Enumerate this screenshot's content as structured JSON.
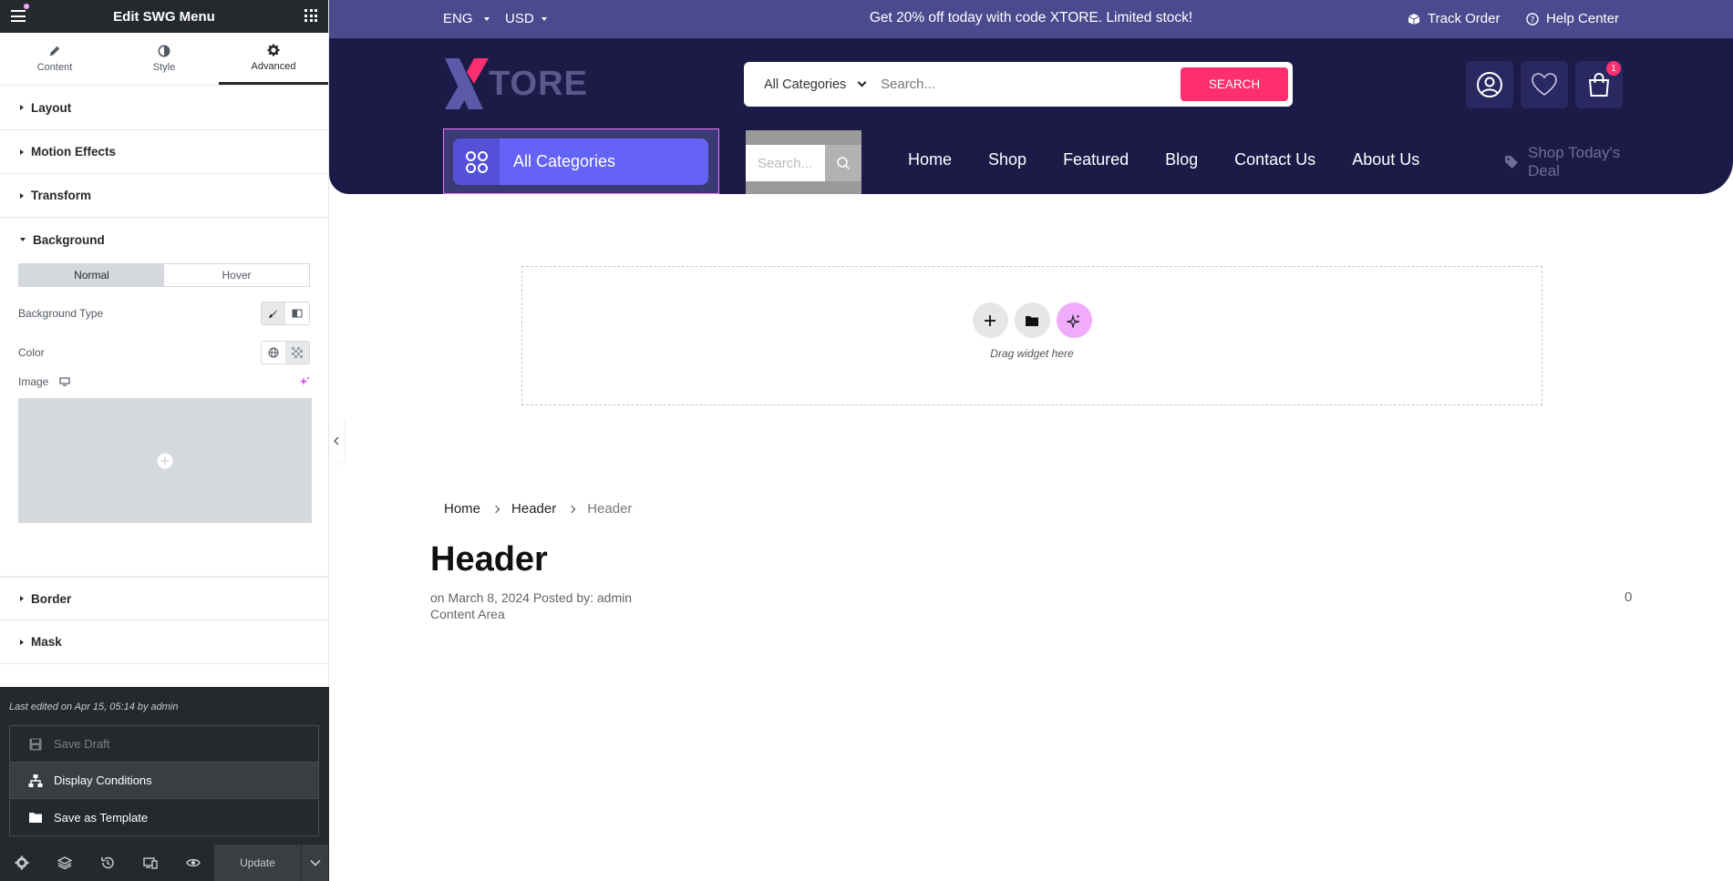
{
  "editor": {
    "title": "Edit SWG Menu",
    "tabs": [
      {
        "label": "Content",
        "icon": "pencil-icon"
      },
      {
        "label": "Style",
        "icon": "contrast-icon"
      },
      {
        "label": "Advanced",
        "icon": "gear-icon",
        "active": true
      }
    ],
    "sections": {
      "layout": "Layout",
      "motion": "Motion Effects",
      "transform": "Transform",
      "background": "Background",
      "border": "Border",
      "mask": "Mask"
    },
    "background": {
      "state_normal": "Normal",
      "state_hover": "Hover",
      "type_label": "Background Type",
      "color_label": "Color",
      "image_label": "Image"
    },
    "footer": {
      "last_edited": "Last edited on Apr 15, 05:14 by admin",
      "save_draft": "Save Draft",
      "display_conditions": "Display Conditions",
      "save_template": "Save as Template",
      "update": "Update"
    }
  },
  "site": {
    "topbar": {
      "language": "ENG",
      "currency": "USD",
      "promo": "Get 20% off today with code XTORE. Limited stock!",
      "track_order": "Track Order",
      "help_center": "Help Center"
    },
    "logo_text": "TORE",
    "search": {
      "category": "All Categories",
      "placeholder": "Search...",
      "button": "SEARCH"
    },
    "cart_count": "1",
    "all_categories": "All Categories",
    "mini_search_placeholder": "Search...",
    "nav": [
      "Home",
      "Shop",
      "Featured",
      "Blog",
      "Contact Us",
      "About Us"
    ],
    "deal": [
      "Shop Today's",
      "Deal"
    ],
    "colors": {
      "topbar": "#4b4a8f",
      "header": "#1c1a47",
      "accent": "#ff2e6e",
      "allcat": "#6562f6"
    }
  },
  "canvas": {
    "drop_text": "Drag widget here"
  },
  "page": {
    "breadcrumb": [
      "Home",
      "Header",
      "Header"
    ],
    "title": "Header",
    "meta_line": "on March 8, 2024 Posted by: admin",
    "meta_line2": "Content Area",
    "comments": "0"
  }
}
